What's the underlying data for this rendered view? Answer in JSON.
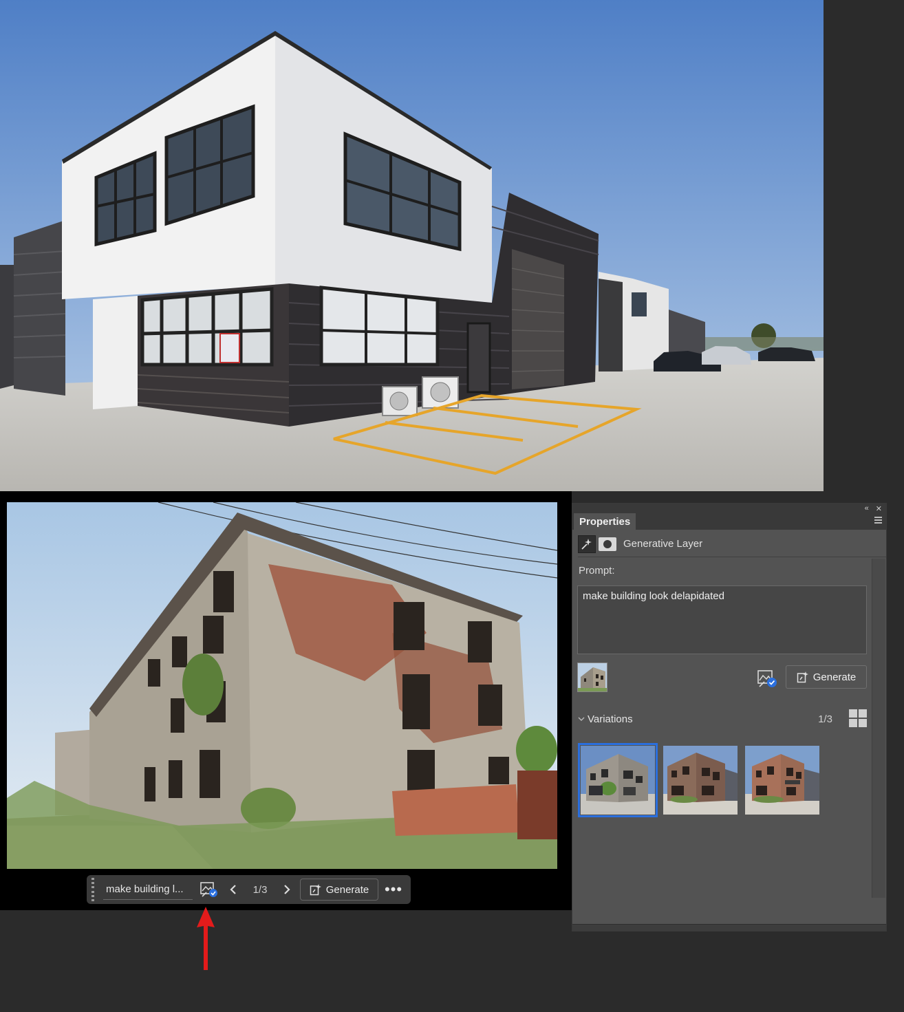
{
  "taskbar": {
    "prompt_text": "make building l...",
    "variation_counter": "1/3",
    "generate_label": "Generate",
    "more_label": "•••",
    "prev_icon": "chevron-left-icon",
    "next_icon": "chevron-right-icon"
  },
  "panel": {
    "tab_title": "Properties",
    "layer_name": "Generative Layer",
    "prompt_label": "Prompt:",
    "prompt_value": "make building look delapidated",
    "generate_label": "Generate",
    "variations_label": "Variations",
    "variations_counter": "1/3",
    "collapse_icon": "«",
    "close_icon": "✕",
    "accent_color": "#2a6fde"
  },
  "annotation": {
    "arrow_color": "#e31b1b"
  }
}
